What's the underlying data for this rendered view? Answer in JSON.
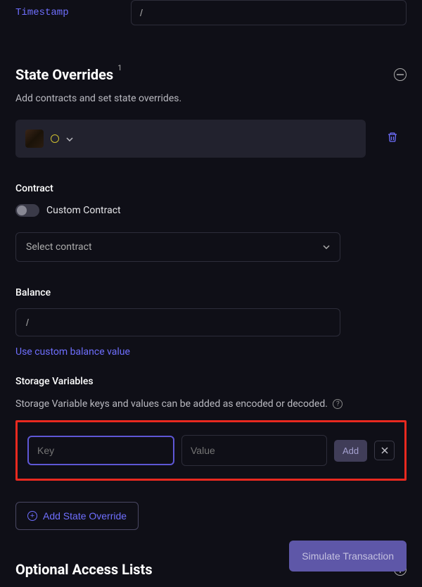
{
  "timestamp": {
    "label": "Timestamp",
    "value": "/"
  },
  "stateOverrides": {
    "title": "State Overrides",
    "count": "1",
    "description": "Add contracts and set state overrides."
  },
  "contract": {
    "label": "Contract",
    "toggleLabel": "Custom Contract",
    "selectPlaceholder": "Select contract"
  },
  "balance": {
    "label": "Balance",
    "value": "/",
    "link": "Use custom balance value"
  },
  "storage": {
    "label": "Storage Variables",
    "help": "Storage Variable keys and values can be added as encoded or decoded.",
    "keyPlaceholder": "Key",
    "valuePlaceholder": "Value",
    "addLabel": "Add"
  },
  "addStateOverride": "Add State Override",
  "accessLists": {
    "title": "Optional Access Lists"
  },
  "simulate": "Simulate Transaction"
}
